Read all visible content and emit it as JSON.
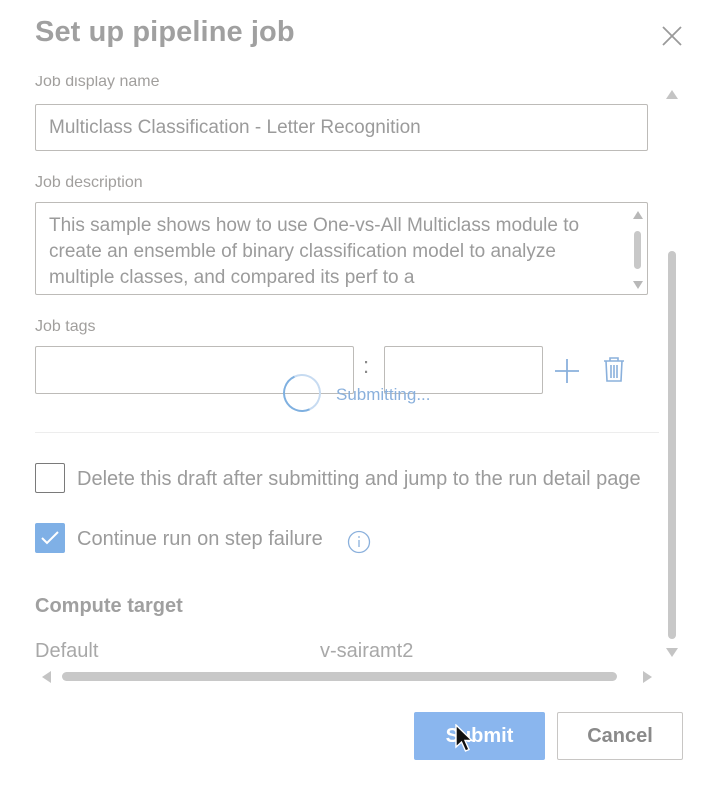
{
  "dialog": {
    "title": "Set up pipeline job"
  },
  "form": {
    "display_name": {
      "label": "Job display name",
      "value": "Multiclass Classification - Letter Recognition"
    },
    "description": {
      "label": "Job description",
      "value": "This sample shows how to use One-vs-All Multiclass module to create an ensemble of binary classification model to analyze multiple classes, and compared its perf to a"
    },
    "tags": {
      "label": "Job tags",
      "key_value": "",
      "value_value": "",
      "separator": ":"
    },
    "status": {
      "submitting_label": "Submitting..."
    },
    "options": {
      "delete_draft": {
        "label": "Delete this draft after submitting and jump to the run detail page",
        "checked": false
      },
      "continue_on_failure": {
        "label": "Continue run on step failure",
        "checked": true
      }
    },
    "compute": {
      "title": "Compute target",
      "key": "Default",
      "value": "v-sairamt2"
    }
  },
  "footer": {
    "submit_label": "Submit",
    "cancel_label": "Cancel"
  },
  "colors": {
    "primary_disabled": "#8ab6ee",
    "accent": "#7fb0e6",
    "muted_text": "#9b9b9b"
  },
  "icons": [
    "close-icon",
    "add-icon",
    "delete-icon",
    "info-icon",
    "checkmark-icon",
    "spinner-icon",
    "mouse-cursor-icon"
  ]
}
